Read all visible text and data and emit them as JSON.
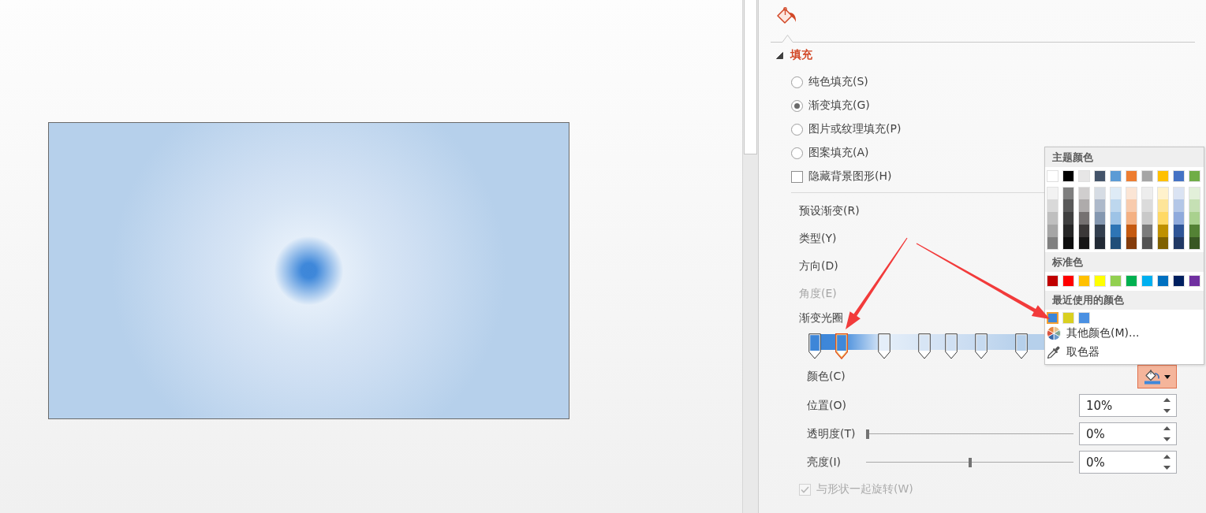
{
  "section": {
    "title": "填充",
    "expanded": true
  },
  "fill_options": [
    {
      "label": "纯色填充(S)",
      "selected": false
    },
    {
      "label": "渐变填充(G)",
      "selected": true
    },
    {
      "label": "图片或纹理填充(P)",
      "selected": false
    },
    {
      "label": "图案填充(A)",
      "selected": false
    }
  ],
  "hide_background": {
    "label": "隐藏背景图形(H)",
    "checked": false
  },
  "gradient_settings": [
    {
      "label": "预设渐变(R)",
      "disabled": false
    },
    {
      "label": "类型(Y)",
      "disabled": false
    },
    {
      "label": "方向(D)",
      "disabled": false
    },
    {
      "label": "角度(E)",
      "disabled": true
    }
  ],
  "gradient": {
    "label": "渐变光圈",
    "stops": [
      {
        "color": "#3d86d8",
        "level": 0,
        "selected": false
      },
      {
        "color": "#3f88da",
        "level": 0.1,
        "selected": true
      },
      {
        "color": "#e4eef9",
        "level": 0.26,
        "selected": false
      },
      {
        "color": "#d7e5f5",
        "level": 0.41,
        "selected": false
      },
      {
        "color": "#d0e0f3",
        "level": 0.51,
        "selected": false
      },
      {
        "color": "#c6daf0",
        "level": 0.62,
        "selected": false
      },
      {
        "color": "#b6d0eb",
        "level": 0.77,
        "selected": false
      }
    ]
  },
  "stop_properties": [
    {
      "kind": "color",
      "label": "颜色(C)"
    },
    {
      "kind": "spin",
      "label": "位置(O)",
      "value": "10%"
    },
    {
      "kind": "slider",
      "label": "透明度(T)",
      "level": 0,
      "value": "0%"
    },
    {
      "kind": "slider",
      "label": "亮度(I)",
      "level": 0.5,
      "value": "0%"
    }
  ],
  "rotate_with_shape": {
    "label": "与形状一起旋转(W)",
    "checked": true,
    "disabled": true
  },
  "color_menu": {
    "theme_title": "主题颜色",
    "theme_colors": [
      {
        "color": "#ffffff",
        "shades": [
          {
            "color": "#f2f2f2"
          },
          {
            "color": "#d9d9d9"
          },
          {
            "color": "#bfbfbf"
          },
          {
            "color": "#a6a6a6"
          },
          {
            "color": "#808080"
          }
        ]
      },
      {
        "color": "#000000",
        "shades": [
          {
            "color": "#7f7f7f"
          },
          {
            "color": "#595959"
          },
          {
            "color": "#3f3f3f"
          },
          {
            "color": "#262626"
          },
          {
            "color": "#0d0d0d"
          }
        ]
      },
      {
        "color": "#e7e6e6",
        "shades": [
          {
            "color": "#d0cece"
          },
          {
            "color": "#aeabab"
          },
          {
            "color": "#757171"
          },
          {
            "color": "#3b3838"
          },
          {
            "color": "#171616"
          }
        ]
      },
      {
        "color": "#44546a",
        "shades": [
          {
            "color": "#d6dce4"
          },
          {
            "color": "#adb9ca"
          },
          {
            "color": "#8497b0"
          },
          {
            "color": "#333f4f"
          },
          {
            "color": "#222a35"
          }
        ]
      },
      {
        "color": "#5b9bd5",
        "shades": [
          {
            "color": "#deebf6"
          },
          {
            "color": "#bdd7ee"
          },
          {
            "color": "#9dc3e6"
          },
          {
            "color": "#2e75b5"
          },
          {
            "color": "#1f4e79"
          }
        ]
      },
      {
        "color": "#ed7d31",
        "shades": [
          {
            "color": "#fbe5d5"
          },
          {
            "color": "#f8cbad"
          },
          {
            "color": "#f4b183"
          },
          {
            "color": "#c55a11"
          },
          {
            "color": "#843c0c"
          }
        ]
      },
      {
        "color": "#a5a5a5",
        "shades": [
          {
            "color": "#ededed"
          },
          {
            "color": "#dbdbdb"
          },
          {
            "color": "#c9c9c9"
          },
          {
            "color": "#7b7b7b"
          },
          {
            "color": "#525252"
          }
        ]
      },
      {
        "color": "#ffc000",
        "shades": [
          {
            "color": "#fff2cc"
          },
          {
            "color": "#fee599"
          },
          {
            "color": "#ffd965"
          },
          {
            "color": "#bf9000"
          },
          {
            "color": "#7f6000"
          }
        ]
      },
      {
        "color": "#4472c4",
        "shades": [
          {
            "color": "#dae3f3"
          },
          {
            "color": "#b4c7e7"
          },
          {
            "color": "#8faadc"
          },
          {
            "color": "#2f5597"
          },
          {
            "color": "#203864"
          }
        ]
      },
      {
        "color": "#70ad47",
        "shades": [
          {
            "color": "#e2f0d9"
          },
          {
            "color": "#c5e0b4"
          },
          {
            "color": "#a9d18e"
          },
          {
            "color": "#548235"
          },
          {
            "color": "#385723"
          }
        ]
      }
    ],
    "standard_title": "标准色",
    "standard_colors": [
      {
        "color": "#c00000"
      },
      {
        "color": "#ff0000"
      },
      {
        "color": "#ffc000"
      },
      {
        "color": "#ffff00"
      },
      {
        "color": "#92d050"
      },
      {
        "color": "#00b050"
      },
      {
        "color": "#00b0f0"
      },
      {
        "color": "#0070c0"
      },
      {
        "color": "#002060"
      },
      {
        "color": "#7030a0"
      }
    ],
    "recent_title": "最近使用的颜色",
    "recent_colors": [
      {
        "color": "#3d86d8",
        "selected": true
      },
      {
        "color": "#d9d021",
        "selected": false
      },
      {
        "color": "#4a90e2",
        "selected": false
      }
    ],
    "items": [
      {
        "kind": "more",
        "label": "其他颜色(M)..."
      },
      {
        "kind": "eyedropper",
        "label": "取色器"
      }
    ]
  }
}
